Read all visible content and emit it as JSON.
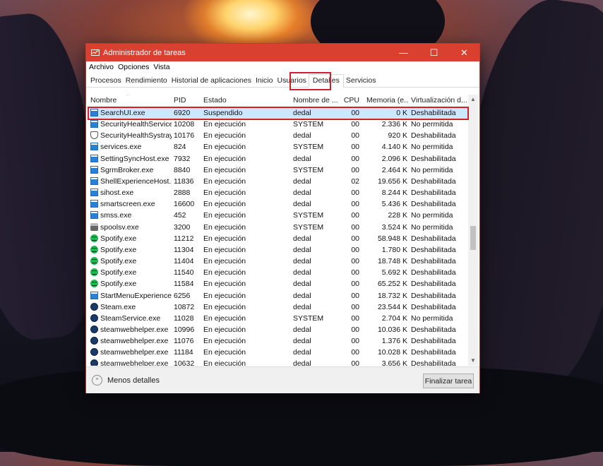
{
  "window": {
    "title": "Administrador de tareas",
    "controls": [
      "—",
      "☐",
      "✕"
    ]
  },
  "menu": [
    "Archivo",
    "Opciones",
    "Vista"
  ],
  "tabs": [
    "Procesos",
    "Rendimiento",
    "Historial de aplicaciones",
    "Inicio",
    "Usuarios",
    "Detalles",
    "Servicios"
  ],
  "active_tab": "Detalles",
  "columns": [
    "Nombre",
    "PID",
    "Estado",
    "Nombre de ...",
    "CPU",
    "Memoria (e...",
    "Virtualización d..."
  ],
  "rows": [
    {
      "icon": "app-icon",
      "name": "SearchUI.exe",
      "pid": "6920",
      "status": "Suspendido",
      "user": "dedal",
      "cpu": "00",
      "mem": "0 K",
      "virt": "Deshabilitada"
    },
    {
      "icon": "app-icon",
      "name": "SecurityHealthService...",
      "pid": "10208",
      "status": "En ejecución",
      "user": "SYSTEM",
      "cpu": "00",
      "mem": "2.336 K",
      "virt": "No permitida"
    },
    {
      "icon": "shield-icon",
      "name": "SecurityHealthSystray...",
      "pid": "10176",
      "status": "En ejecución",
      "user": "dedal",
      "cpu": "00",
      "mem": "920 K",
      "virt": "Deshabilitada"
    },
    {
      "icon": "app-icon",
      "name": "services.exe",
      "pid": "824",
      "status": "En ejecución",
      "user": "SYSTEM",
      "cpu": "00",
      "mem": "4.140 K",
      "virt": "No permitida"
    },
    {
      "icon": "app-icon",
      "name": "SettingSyncHost.exe",
      "pid": "7932",
      "status": "En ejecución",
      "user": "dedal",
      "cpu": "00",
      "mem": "2.096 K",
      "virt": "Deshabilitada"
    },
    {
      "icon": "app-icon",
      "name": "SgrmBroker.exe",
      "pid": "8840",
      "status": "En ejecución",
      "user": "SYSTEM",
      "cpu": "00",
      "mem": "2.464 K",
      "virt": "No permitida"
    },
    {
      "icon": "app-icon",
      "name": "ShellExperienceHost.e...",
      "pid": "11836",
      "status": "En ejecución",
      "user": "dedal",
      "cpu": "02",
      "mem": "19.656 K",
      "virt": "Deshabilitada"
    },
    {
      "icon": "app-icon",
      "name": "sihost.exe",
      "pid": "2888",
      "status": "En ejecución",
      "user": "dedal",
      "cpu": "00",
      "mem": "8.244 K",
      "virt": "Deshabilitada"
    },
    {
      "icon": "app-icon",
      "name": "smartscreen.exe",
      "pid": "16600",
      "status": "En ejecución",
      "user": "dedal",
      "cpu": "00",
      "mem": "5.436 K",
      "virt": "Deshabilitada"
    },
    {
      "icon": "app-icon",
      "name": "smss.exe",
      "pid": "452",
      "status": "En ejecución",
      "user": "SYSTEM",
      "cpu": "00",
      "mem": "228 K",
      "virt": "No permitida"
    },
    {
      "icon": "printer-icon",
      "name": "spoolsv.exe",
      "pid": "3200",
      "status": "En ejecución",
      "user": "SYSTEM",
      "cpu": "00",
      "mem": "3.524 K",
      "virt": "No permitida"
    },
    {
      "icon": "spotify-icon",
      "name": "Spotify.exe",
      "pid": "11212",
      "status": "En ejecución",
      "user": "dedal",
      "cpu": "00",
      "mem": "58.948 K",
      "virt": "Deshabilitada"
    },
    {
      "icon": "spotify-icon",
      "name": "Spotify.exe",
      "pid": "11304",
      "status": "En ejecución",
      "user": "dedal",
      "cpu": "00",
      "mem": "1.780 K",
      "virt": "Deshabilitada"
    },
    {
      "icon": "spotify-icon",
      "name": "Spotify.exe",
      "pid": "11404",
      "status": "En ejecución",
      "user": "dedal",
      "cpu": "00",
      "mem": "18.748 K",
      "virt": "Deshabilitada"
    },
    {
      "icon": "spotify-icon",
      "name": "Spotify.exe",
      "pid": "11540",
      "status": "En ejecución",
      "user": "dedal",
      "cpu": "00",
      "mem": "5.692 K",
      "virt": "Deshabilitada"
    },
    {
      "icon": "spotify-icon",
      "name": "Spotify.exe",
      "pid": "11584",
      "status": "En ejecución",
      "user": "dedal",
      "cpu": "00",
      "mem": "65.252 K",
      "virt": "Deshabilitada"
    },
    {
      "icon": "app-icon",
      "name": "StartMenuExperience...",
      "pid": "6256",
      "status": "En ejecución",
      "user": "dedal",
      "cpu": "00",
      "mem": "18.732 K",
      "virt": "Deshabilitada"
    },
    {
      "icon": "steam-icon",
      "name": "Steam.exe",
      "pid": "10872",
      "status": "En ejecución",
      "user": "dedal",
      "cpu": "00",
      "mem": "23.544 K",
      "virt": "Deshabilitada"
    },
    {
      "icon": "steam-icon",
      "name": "SteamService.exe",
      "pid": "11028",
      "status": "En ejecución",
      "user": "SYSTEM",
      "cpu": "00",
      "mem": "2.704 K",
      "virt": "No permitida"
    },
    {
      "icon": "steam-icon",
      "name": "steamwebhelper.exe",
      "pid": "10996",
      "status": "En ejecución",
      "user": "dedal",
      "cpu": "00",
      "mem": "10.036 K",
      "virt": "Deshabilitada"
    },
    {
      "icon": "steam-icon",
      "name": "steamwebhelper.exe",
      "pid": "11076",
      "status": "En ejecución",
      "user": "dedal",
      "cpu": "00",
      "mem": "1.376 K",
      "virt": "Deshabilitada"
    },
    {
      "icon": "steam-icon",
      "name": "steamwebhelper.exe",
      "pid": "11184",
      "status": "En ejecución",
      "user": "dedal",
      "cpu": "00",
      "mem": "10.028 K",
      "virt": "Deshabilitada"
    },
    {
      "icon": "steam-icon",
      "name": "steamwebhelper.exe",
      "pid": "10632",
      "status": "En ejecución",
      "user": "dedal",
      "cpu": "00",
      "mem": "3.656 K",
      "virt": "Deshabilitada"
    }
  ],
  "selected_row": 0,
  "footer": {
    "less_details": "Menos detalles",
    "end_task": "Finalizar tarea"
  },
  "colors": {
    "titlebar": "#d9402f",
    "selection": "#cce8ff",
    "highlight_box": "#d21f2b"
  }
}
